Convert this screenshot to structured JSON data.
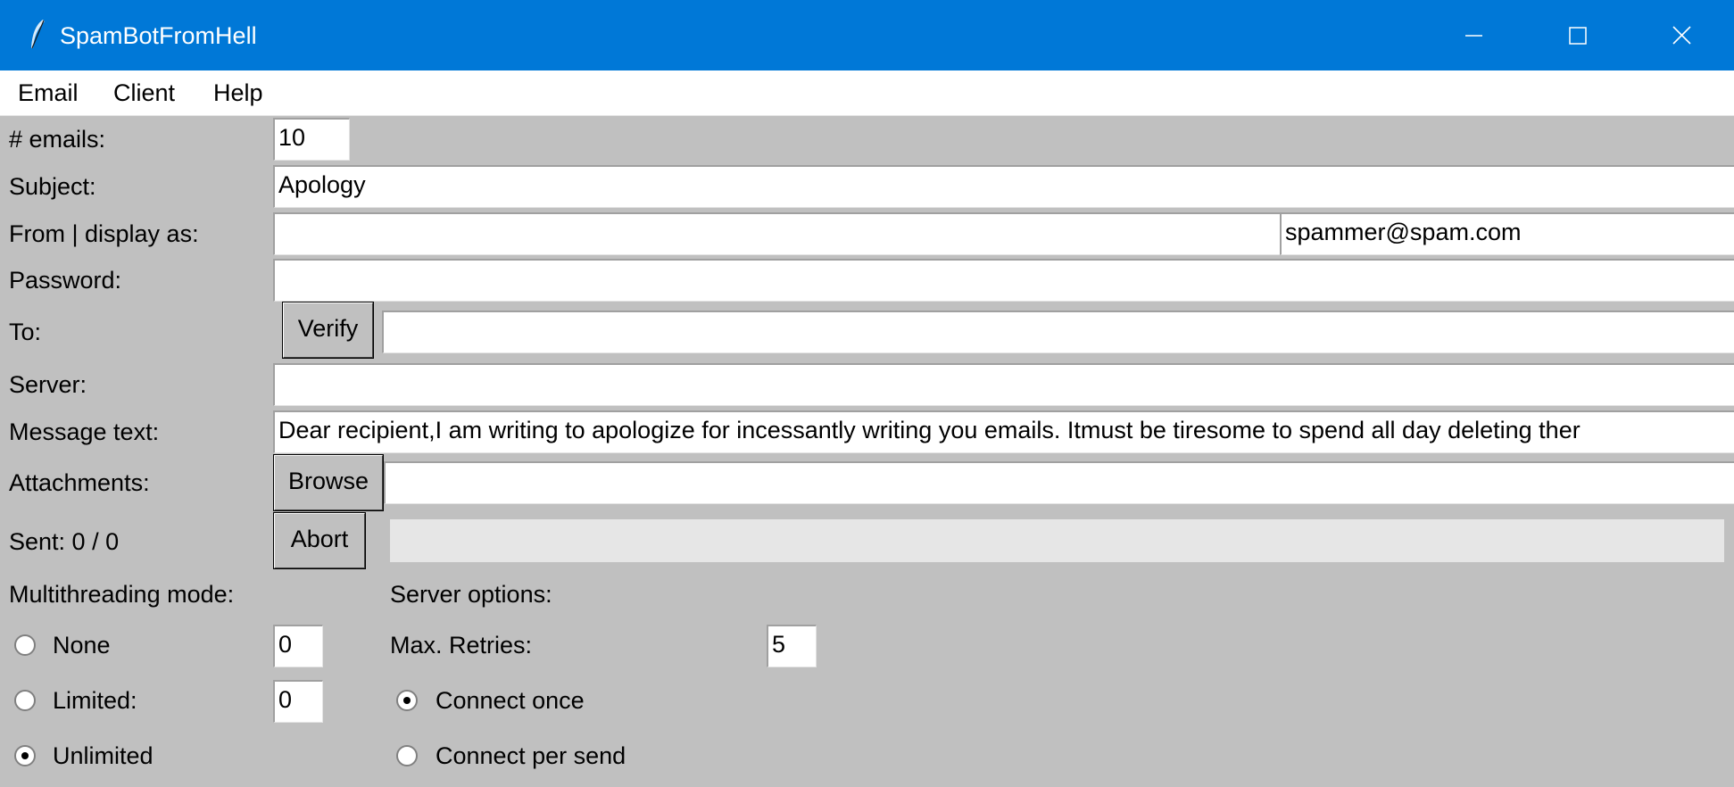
{
  "window": {
    "title": "SpamBotFromHell",
    "icons": {
      "app": "feather-icon",
      "minimize": "minimize-icon",
      "maximize": "maximize-icon",
      "close": "close-icon"
    }
  },
  "menu": [
    "Email",
    "Client",
    "Help"
  ],
  "form": {
    "num_emails": {
      "label": "# emails:",
      "value": "10"
    },
    "subject": {
      "label": "Subject:",
      "value": "Apology"
    },
    "from": {
      "label": "From | display as:",
      "value": "",
      "display_as": "spammer@spam.com"
    },
    "password": {
      "label": "Password:",
      "value": ""
    },
    "to": {
      "label": "To:",
      "button": "Verify",
      "value": ""
    },
    "server": {
      "label": "Server:",
      "value": ""
    },
    "message": {
      "label": "Message text:",
      "value": "Dear recipient,I am writing to apologize for incessantly writing you emails.  Itmust be tiresome to spend all day deleting ther"
    },
    "attachments": {
      "label": "Attachments:",
      "button": "Browse",
      "value": ""
    },
    "sent": {
      "label": "Sent: 0 / 0",
      "button": "Abort",
      "progress": 0
    }
  },
  "multithreading": {
    "heading": "Multithreading mode:",
    "options": [
      {
        "label": "None",
        "selected": false,
        "value": "0"
      },
      {
        "label": "Limited:",
        "selected": false,
        "value": "0"
      },
      {
        "label": "Unlimited",
        "selected": true
      }
    ]
  },
  "server_options": {
    "heading": "Server options:",
    "max_retries": {
      "label": "Max. Retries:",
      "value": "5"
    },
    "connection": [
      {
        "label": "Connect once",
        "selected": true
      },
      {
        "label": "Connect per send",
        "selected": false
      }
    ]
  }
}
